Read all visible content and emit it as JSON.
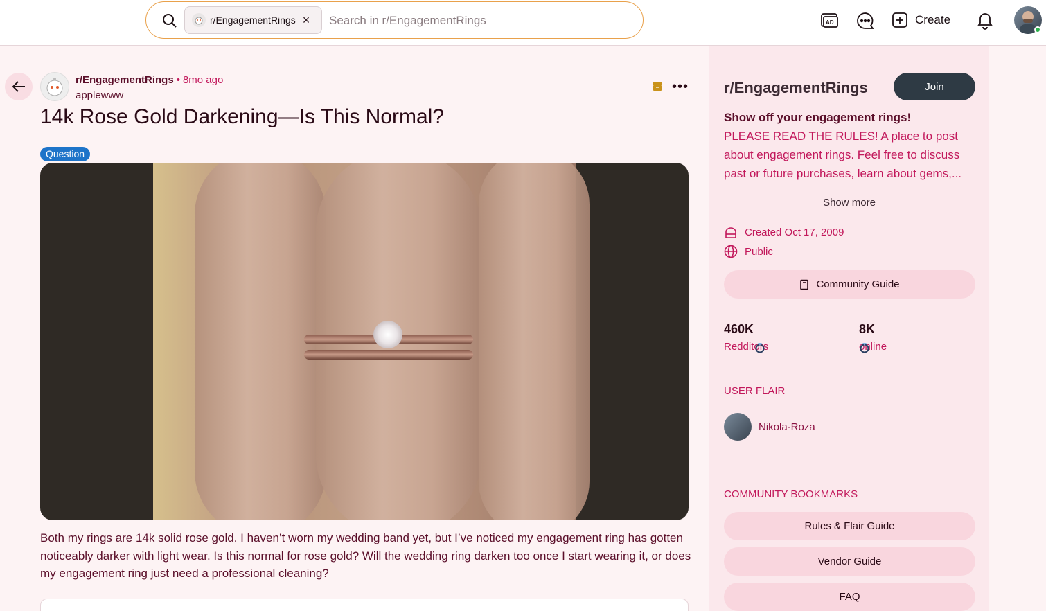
{
  "header": {
    "search_chip_label": "r/EngagementRings",
    "search_placeholder": "Search in r/EngagementRings",
    "create_label": "Create",
    "icons": [
      "ad-icon",
      "chat-icon",
      "plus-square-icon",
      "bell-icon"
    ]
  },
  "post": {
    "subreddit": "r/EngagementRings",
    "separator": "•",
    "time_ago": "8mo ago",
    "author": "applewww",
    "title": "14k Rose Gold Darkening—Is This Normal?",
    "flair": "Question",
    "body": "Both my rings are 14k solid rose gold. I haven’t worn my wedding band yet, but I’ve noticed my engagement ring has gotten noticeably darker with light wear. Is this normal for rose gold? Will the wedding ring darken too once I start wearing it, or does my engagement ring just need a professional cleaning?"
  },
  "sidebar": {
    "title": "r/EngagementRings",
    "join_label": "Join",
    "tagline": "Show off your engagement rings!",
    "description": "PLEASE READ THE RULES! A place to post about engagement rings. Feel free to discuss past or future purchases, learn about gems,...",
    "show_more": "Show more",
    "created": "Created Oct 17, 2009",
    "visibility": "Public",
    "community_guide": "Community Guide",
    "stats": [
      {
        "value": "460K",
        "label": "Redditors",
        "icon": "ring-icon"
      },
      {
        "value": "8K",
        "label": "online",
        "icon": "ring-icon"
      }
    ],
    "user_flair_heading": "USER FLAIR",
    "user_flair_name": "Nikola-Roza",
    "bookmarks_heading": "COMMUNITY BOOKMARKS",
    "bookmarks": [
      "Rules & Flair Guide",
      "Vendor Guide",
      "FAQ"
    ]
  },
  "colors": {
    "accent": "#c2185b",
    "dark_text": "#5b0f2a",
    "sidebar_bg": "#fbe8ec",
    "flair_bg": "#1e74c9",
    "join_bg": "#2e3a44"
  }
}
